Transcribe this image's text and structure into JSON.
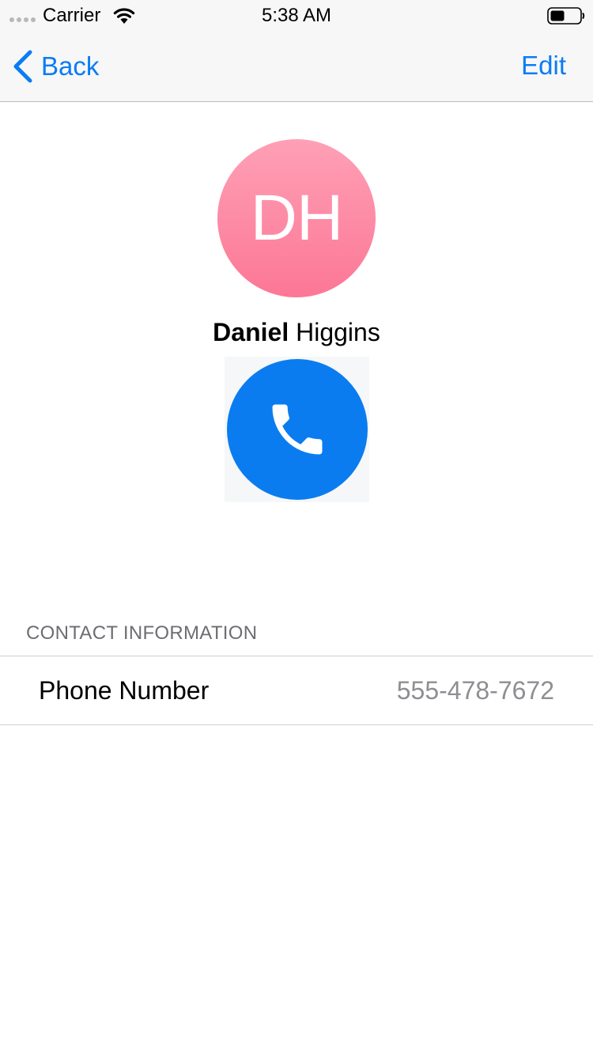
{
  "status_bar": {
    "carrier": "Carrier",
    "time": "5:38 AM"
  },
  "nav": {
    "back_label": "Back",
    "edit_label": "Edit"
  },
  "contact": {
    "initials": "DH",
    "first_name": "Daniel",
    "last_name": "Higgins"
  },
  "section": {
    "header": "CONTACT INFORMATION",
    "rows": [
      {
        "label": "Phone Number",
        "value": "555-478-7672"
      }
    ]
  },
  "colors": {
    "accent": "#0a7cf5",
    "avatar_top": "#fea0b6",
    "avatar_bottom": "#fc7795",
    "call_button": "#0a7cf0",
    "secondary_text": "#8e8e93"
  },
  "icons": {
    "back": "chevron-left-icon",
    "call": "phone-icon",
    "wifi": "wifi-icon",
    "battery": "battery-icon"
  }
}
